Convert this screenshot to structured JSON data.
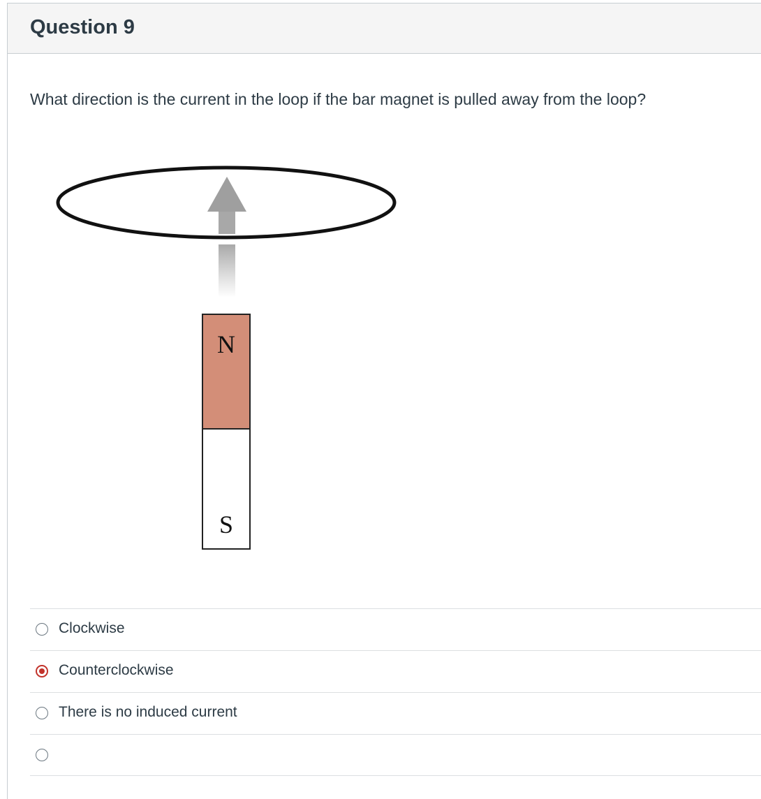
{
  "question": {
    "title": "Question 9",
    "text": "What direction is the current in the loop if the bar magnet is pulled away from the loop?"
  },
  "figure": {
    "magnet": {
      "north_label": "N",
      "south_label": "S",
      "north_color": "#d38e78",
      "south_color": "#ffffff"
    },
    "arrow_icon": "up-arrow-icon",
    "loop_icon": "wire-loop-icon"
  },
  "answers": [
    {
      "label": "Clockwise",
      "selected": false
    },
    {
      "label": "Counterclockwise",
      "selected": true
    },
    {
      "label": "There is no induced current",
      "selected": false
    },
    {
      "label": "",
      "selected": false
    }
  ],
  "colors": {
    "accent": "#c2332b",
    "text": "#2d3b45",
    "header_bg": "#f5f5f5"
  }
}
